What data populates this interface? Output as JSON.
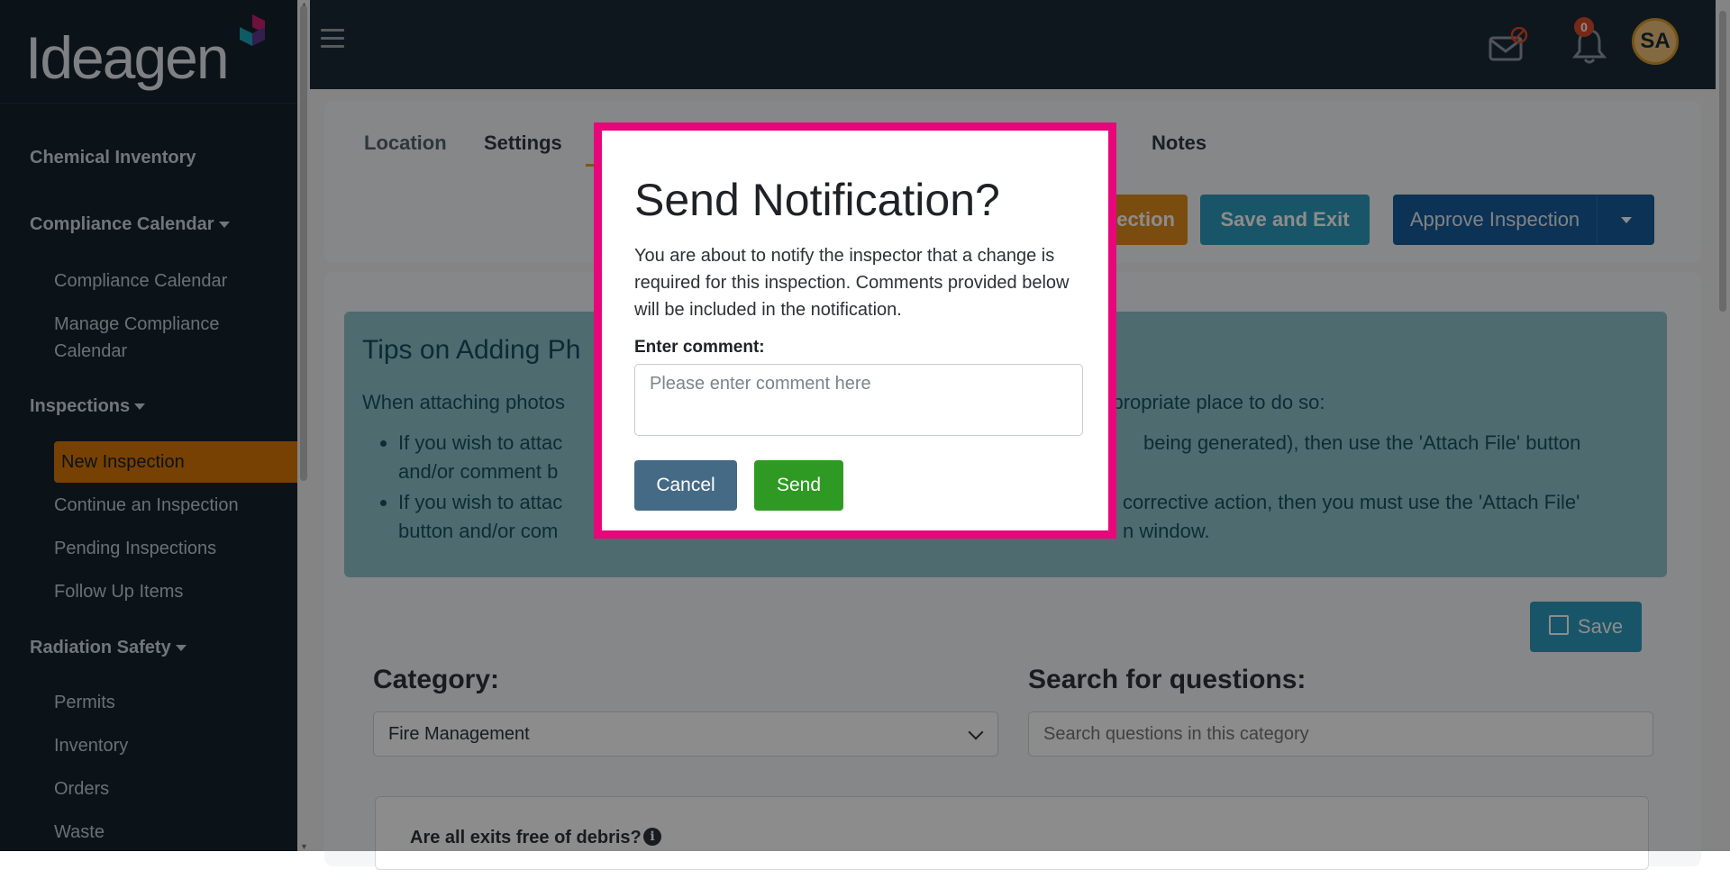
{
  "brand": {
    "name": "Ideagen",
    "mark_colors": [
      "#c81f6e",
      "#1aa4b8",
      "#5b3a8c"
    ]
  },
  "sidebar": {
    "sections": [
      {
        "label": "Chemical Inventory"
      },
      {
        "label": "Compliance Calendar",
        "items": [
          "Compliance Calendar",
          "Manage Compliance",
          "Calendar"
        ]
      },
      {
        "label": "Inspections",
        "items": [
          "New Inspection",
          "Continue an Inspection",
          "Pending Inspections",
          "Follow Up Items"
        ]
      },
      {
        "label": "Radiation Safety",
        "items": [
          "Permits",
          "Inventory",
          "Orders",
          "Waste"
        ]
      }
    ],
    "active_item": "New Inspection",
    "accent_color": "#d97706"
  },
  "topbar": {
    "icons": [
      "menu-icon",
      "mail-blocked-icon",
      "bell-icon"
    ],
    "notification_count": "0",
    "avatar_initials": "SA"
  },
  "tabs": [
    "Location",
    "Settings",
    "Notes"
  ],
  "actions": {
    "partial_label": "ection",
    "save_exit": "Save and Exit",
    "approve": "Approve Inspection",
    "save": "Save"
  },
  "tips": {
    "title_partial": "Tips on Adding Ph",
    "intro_left": "When attaching photos",
    "intro_right": "appropriate place to do so:",
    "bullet1_a": "If you wish to attac",
    "bullet1_b": "being generated), then use the 'Attach File' button",
    "bullet1_c": "and/or comment b",
    "bullet2_a": "If you wish to attac",
    "bullet2_b": "corrective action, then you must use the 'Attach File'",
    "bullet2_c": "button and/or com",
    "bullet2_d": "n window."
  },
  "form": {
    "category_label": "Category:",
    "category_value": "Fire Management",
    "search_label": "Search for questions:",
    "search_placeholder": "Search questions in this category",
    "question": "Are all exits free of debris?"
  },
  "modal": {
    "title": "Send Notification?",
    "message": "You are about to notify the inspector that a change is required for this inspection. Comments provided below will be included in the notification.",
    "comment_label": "Enter comment:",
    "comment_placeholder": "Please enter comment here",
    "cancel": "Cancel",
    "send": "Send",
    "border_color": "#e8077a"
  }
}
